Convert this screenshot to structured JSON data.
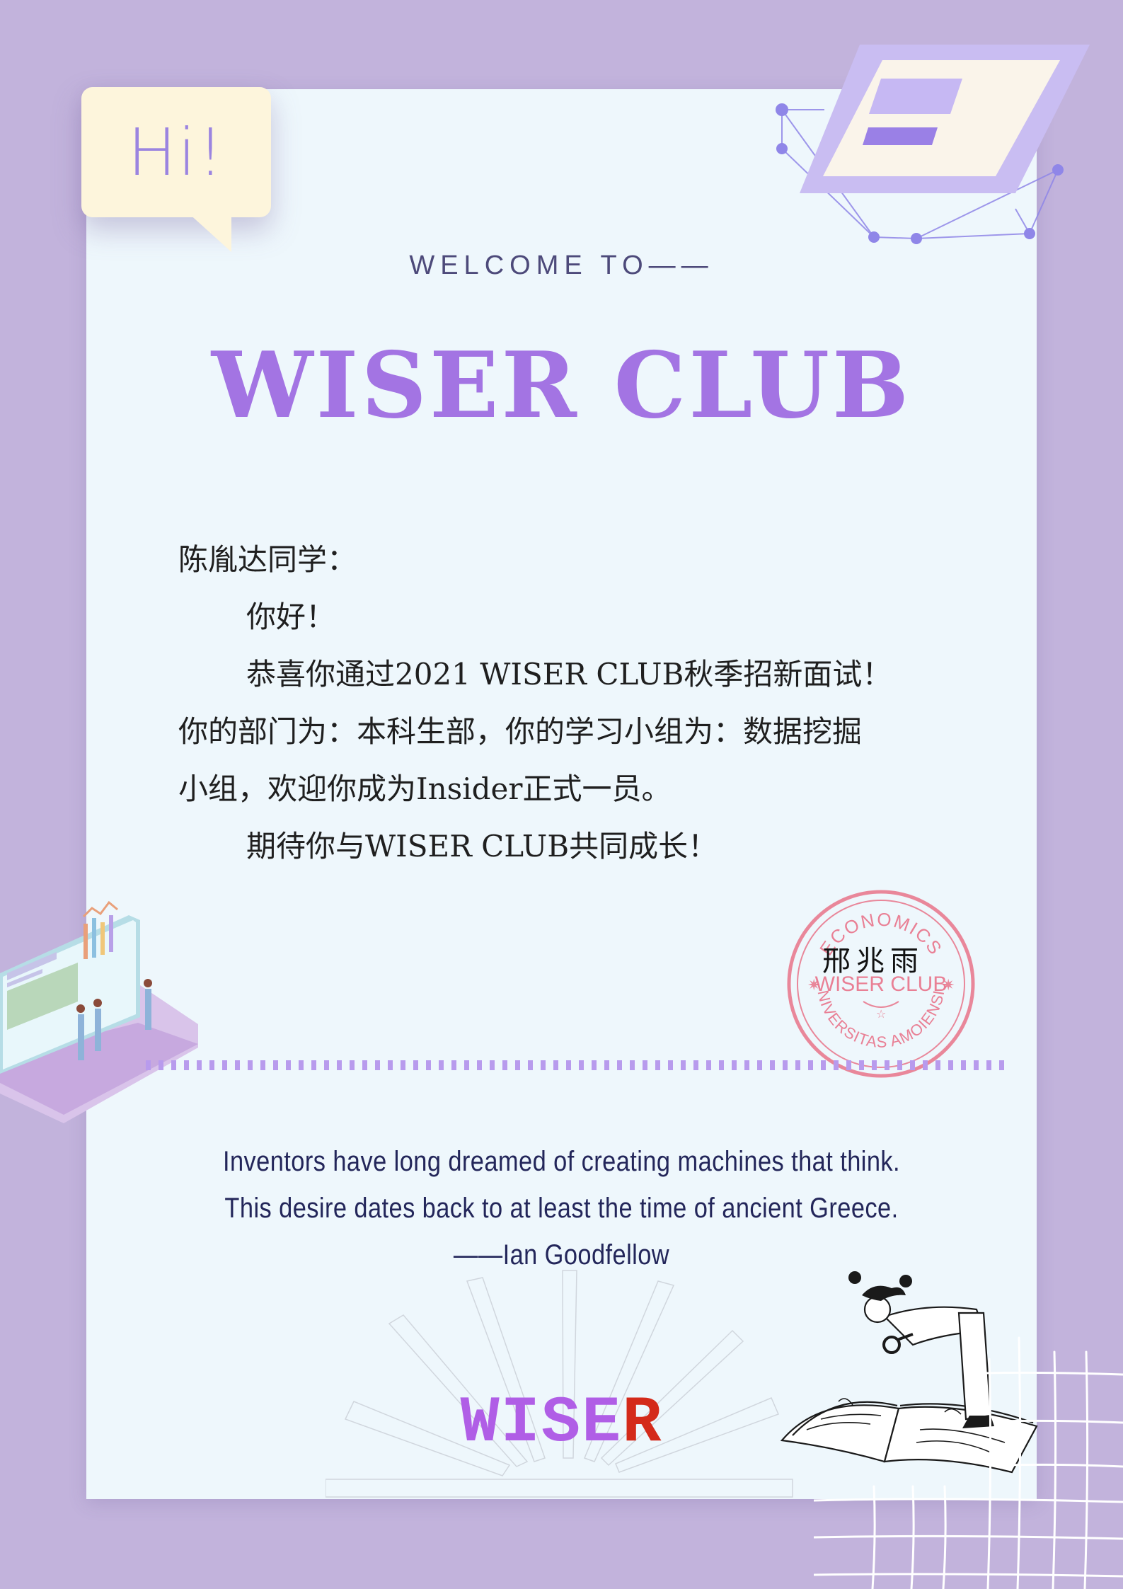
{
  "greeting_bubble": "Hi!",
  "welcome": "WELCOME TO——",
  "title": "WISER CLUB",
  "letter": {
    "salutation": "陈胤达同学：",
    "hello": "你好！",
    "line1": "恭喜你通过2021 WISER CLUB秋季招新面试！",
    "line2": "你的部门为：本科生部，你的学习小组为：数据挖掘",
    "line3": "小组，欢迎你成为Insider正式一员。",
    "closing": "期待你与WISER CLUB共同成长！"
  },
  "signature": "邢兆雨",
  "stamp": {
    "top_text": "ECONOMICS",
    "center_text": "WISER CLUB",
    "bottom_text": "UNIVERSITAS AMOIENSIS",
    "color": "#e7627a"
  },
  "quote": {
    "line1": "Inventors have long dreamed of creating machines that think.",
    "line2": "This desire dates back to at least the time of ancient Greece.",
    "attribution": "——Ian Goodfellow"
  },
  "logo": {
    "part1": "WISE",
    "part2": "R",
    "color1": "#b05ee6",
    "color2": "#d42a1a"
  },
  "colors": {
    "background": "#c2b3dc",
    "card": "#eef7fc",
    "accent": "#a374e3"
  }
}
